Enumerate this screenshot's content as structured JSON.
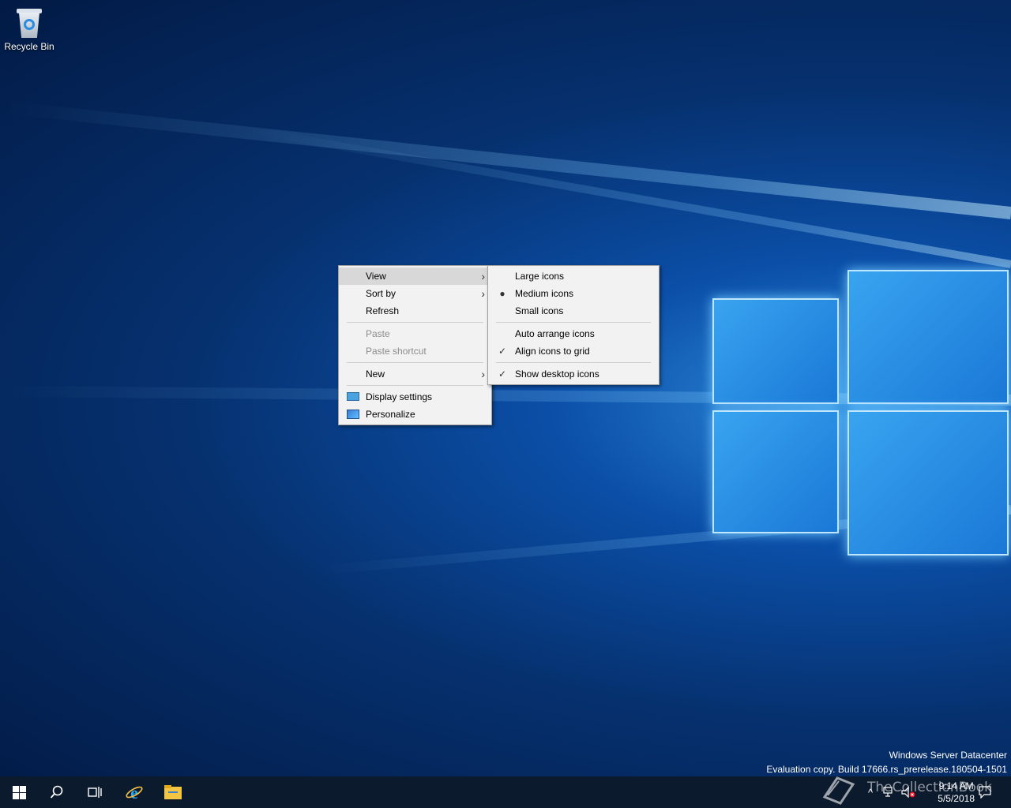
{
  "desktop": {
    "icons": [
      {
        "label": "Recycle Bin",
        "icon": "recycle-bin-icon"
      }
    ]
  },
  "context_menu": {
    "items": [
      {
        "label": "View",
        "submenu": true,
        "selected": true
      },
      {
        "label": "Sort by",
        "submenu": true
      },
      {
        "label": "Refresh"
      },
      {
        "label": "Paste",
        "disabled": true
      },
      {
        "label": "Paste shortcut",
        "disabled": true
      },
      {
        "label": "New",
        "submenu": true
      },
      {
        "label": "Display settings",
        "icon": "display-settings-icon"
      },
      {
        "label": "Personalize",
        "icon": "personalize-icon"
      }
    ]
  },
  "view_submenu": {
    "items": [
      {
        "label": "Large icons"
      },
      {
        "label": "Medium icons",
        "bullet": true
      },
      {
        "label": "Small icons"
      },
      {
        "label": "Auto arrange icons"
      },
      {
        "label": "Align icons to grid",
        "checked": true
      },
      {
        "label": "Show desktop icons",
        "checked": true
      }
    ]
  },
  "watermark": {
    "line1": "Windows Server Datacenter",
    "line2": "Evaluation copy. Build 17666.rs_prerelease.180504-1501"
  },
  "taskbar": {
    "buttons": [
      "start-icon",
      "search-icon",
      "task-view-icon",
      "internet-explorer-icon",
      "file-explorer-icon"
    ],
    "clock": {
      "time": "9:14 AM",
      "date": "5/5/2018"
    },
    "tray": [
      "chevron-up-icon",
      "network-icon",
      "volume-muted-icon",
      "action-center-icon"
    ]
  },
  "overlay_logo": {
    "text": "TheCollectionBook"
  }
}
